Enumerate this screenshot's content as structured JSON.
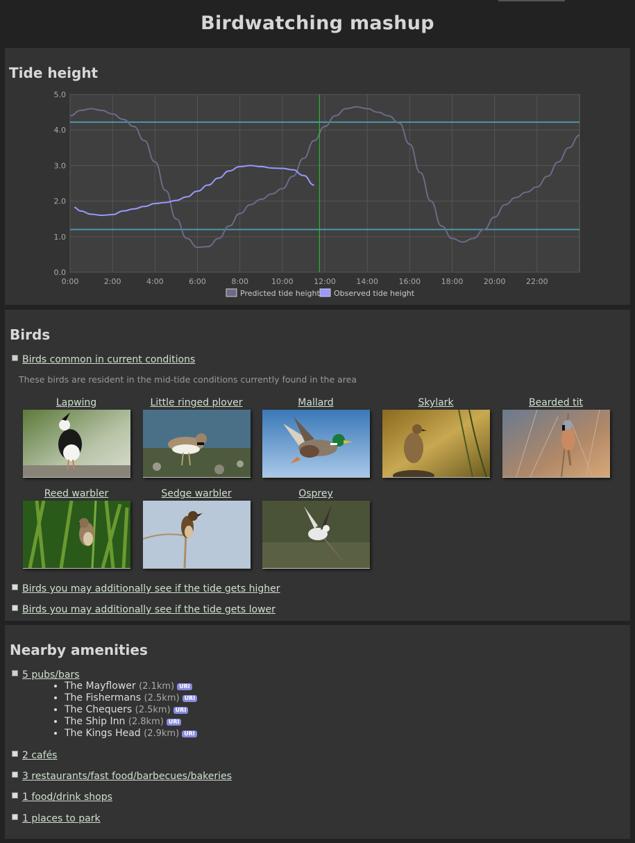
{
  "page": {
    "title": "Birdwatching mashup"
  },
  "tide": {
    "heading": "Tide height",
    "legend": {
      "predicted": "Predicted tide height",
      "observed": "Observed tide height"
    }
  },
  "chart_data": {
    "type": "line",
    "title": "",
    "xlabel": "",
    "ylabel": "",
    "xlim": [
      0,
      24
    ],
    "ylim": [
      0,
      5
    ],
    "x_ticks": [
      "0:00",
      "2:00",
      "4:00",
      "6:00",
      "8:00",
      "10:00",
      "12:00",
      "14:00",
      "16:00",
      "18:00",
      "20:00",
      "22:00"
    ],
    "y_ticks": [
      "0.0",
      "1.0",
      "2.0",
      "3.0",
      "4.0",
      "5.0"
    ],
    "grid": true,
    "legend_position": "bottom",
    "colors": {
      "predicted": "#6e6a88",
      "observed": "#9999ff",
      "thresholds": "#4a9aaa",
      "now": "#22cc22",
      "background": "#3f3f3f"
    },
    "series": [
      {
        "name": "Predicted tide height",
        "x": [
          0,
          0.5,
          1,
          1.5,
          2,
          2.5,
          3,
          3.5,
          4,
          4.5,
          5,
          5.5,
          6,
          6.5,
          7,
          7.5,
          8,
          8.5,
          9,
          9.5,
          10,
          10.5,
          11,
          11.5,
          12,
          12.5,
          13,
          13.5,
          14,
          14.5,
          15,
          15.5,
          16,
          16.5,
          17,
          17.5,
          18,
          18.5,
          19,
          19.5,
          20,
          20.5,
          21,
          21.5,
          22,
          22.5,
          23,
          23.5,
          24
        ],
        "y": [
          4.4,
          4.55,
          4.6,
          4.55,
          4.45,
          4.3,
          4.1,
          3.7,
          3.1,
          2.3,
          1.5,
          0.95,
          0.7,
          0.72,
          0.95,
          1.3,
          1.65,
          1.9,
          2.05,
          2.2,
          2.35,
          2.7,
          3.2,
          3.7,
          4.1,
          4.4,
          4.6,
          4.65,
          4.6,
          4.5,
          4.4,
          4.2,
          3.6,
          2.8,
          2.0,
          1.3,
          0.95,
          0.85,
          0.95,
          1.2,
          1.55,
          1.9,
          2.1,
          2.25,
          2.4,
          2.7,
          3.1,
          3.5,
          3.85
        ]
      },
      {
        "name": "Observed tide height",
        "x": [
          0.2,
          0.5,
          1,
          1.5,
          2,
          2.5,
          3,
          3.5,
          4,
          4.5,
          5,
          5.5,
          6,
          6.5,
          7,
          7.5,
          8,
          8.5,
          9,
          9.5,
          10,
          10.5,
          11,
          11.5
        ],
        "y": [
          1.82,
          1.72,
          1.63,
          1.6,
          1.62,
          1.72,
          1.78,
          1.85,
          1.93,
          1.96,
          2.02,
          2.12,
          2.28,
          2.45,
          2.65,
          2.85,
          2.97,
          3.0,
          2.97,
          2.93,
          2.92,
          2.88,
          2.72,
          2.45
        ]
      }
    ],
    "thresholds": [
      4.22,
      1.2
    ],
    "now_x": 11.75
  },
  "birds": {
    "heading": "Birds",
    "common_link": "Birds common in current conditions",
    "description": "These birds are resident in the mid-tide conditions currently found in the area",
    "higher_link": "Birds you may additionally see if the tide gets higher",
    "lower_link": "Birds you may additionally see if the tide gets lower",
    "items": [
      {
        "name": "Lapwing"
      },
      {
        "name": "Little ringed plover"
      },
      {
        "name": "Mallard"
      },
      {
        "name": "Skylark"
      },
      {
        "name": "Bearded tit"
      },
      {
        "name": "Reed warbler"
      },
      {
        "name": "Sedge warbler"
      },
      {
        "name": "Osprey"
      }
    ]
  },
  "amenities": {
    "heading": "Nearby amenities",
    "pubs_link": "5 pubs/bars",
    "uri_label": "URI",
    "pubs": [
      {
        "name": "The Mayflower",
        "dist": "(2.1km)"
      },
      {
        "name": "The Fishermans",
        "dist": "(2.5km)"
      },
      {
        "name": "The Chequers",
        "dist": "(2.5km)"
      },
      {
        "name": "The Ship Inn",
        "dist": "(2.8km)"
      },
      {
        "name": "The Kings Head",
        "dist": "(2.9km)"
      }
    ],
    "cafes_link": "2 cafés",
    "restaurants_link": "3 restaurants/fast food/barbecues/bakeries",
    "shops_link": "1 food/drink shops",
    "parking_link": "1 places to park"
  }
}
